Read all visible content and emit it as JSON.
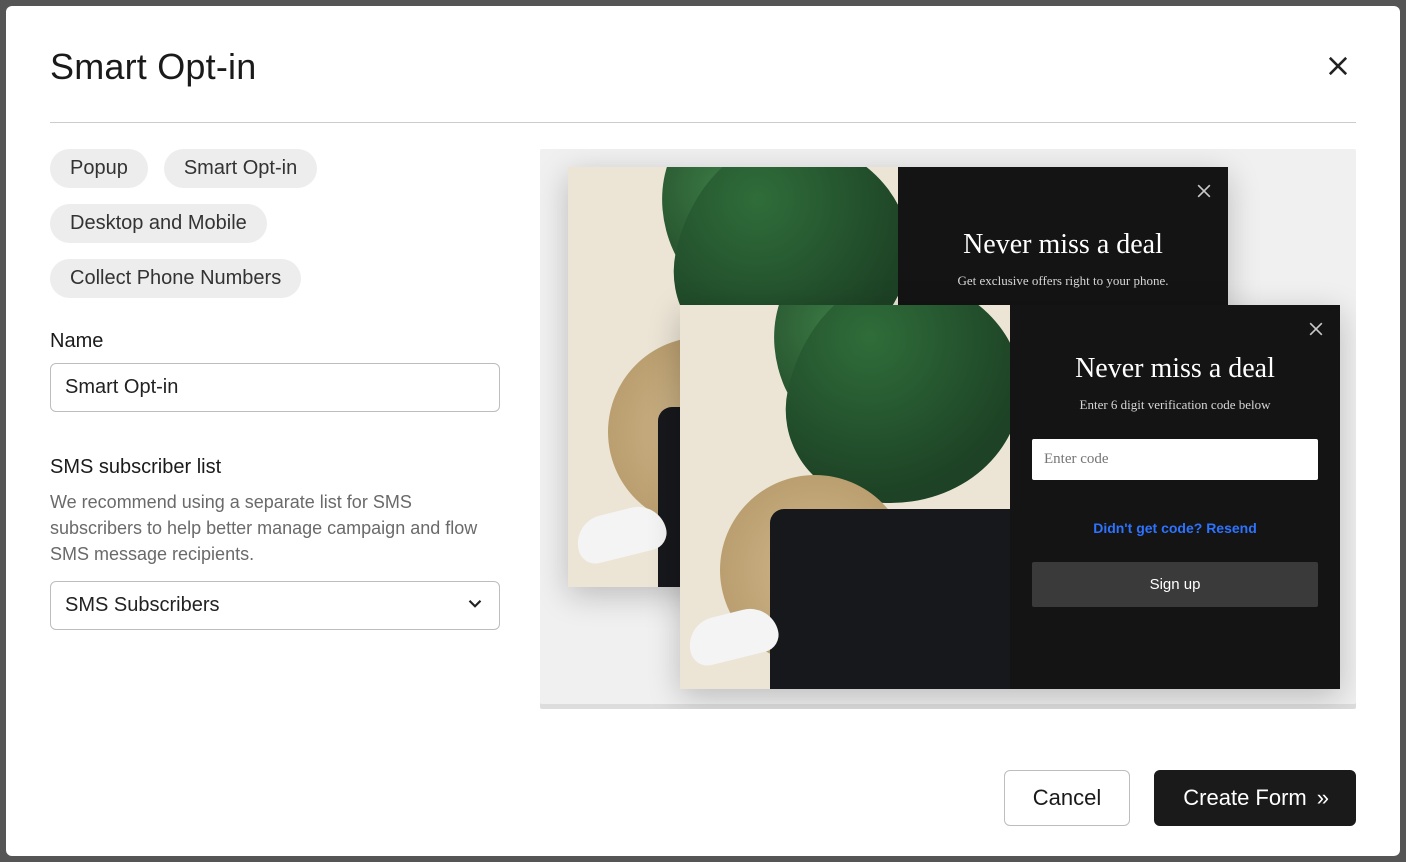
{
  "modal": {
    "title": "Smart Opt-in",
    "tags": [
      "Popup",
      "Smart Opt-in",
      "Desktop and Mobile",
      "Collect Phone Numbers"
    ],
    "name_label": "Name",
    "name_value": "Smart Opt-in",
    "sms_list_label": "SMS subscriber list",
    "sms_list_desc": "We recommend using a separate list for SMS subscribers to help better manage campaign and flow SMS message recipients.",
    "sms_list_selected": "SMS Subscribers"
  },
  "preview": {
    "back_card": {
      "headline": "Never miss a deal",
      "sub": "Get exclusive offers right to your phone."
    },
    "front_card": {
      "headline": "Never miss a deal",
      "sub": "Enter 6 digit verification code below",
      "code_placeholder": "Enter code",
      "resend": "Didn't get code? Resend",
      "signup": "Sign up"
    }
  },
  "footer": {
    "cancel": "Cancel",
    "create": "Create Form",
    "create_arrows": "»"
  }
}
